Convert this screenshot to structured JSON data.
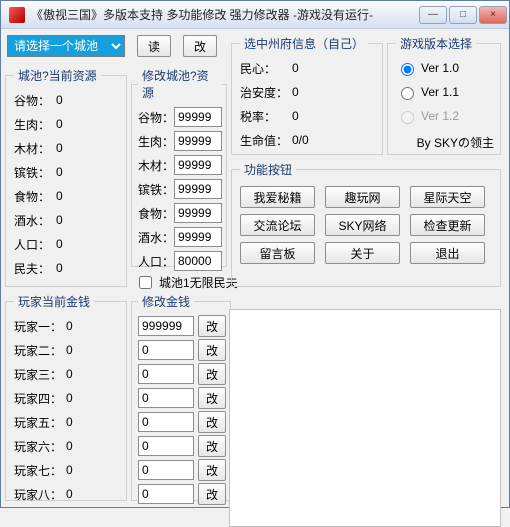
{
  "title": "《傲视三国》多版本支持 多功能修改 强力修改器    -游戏没有运行-",
  "window_buttons": {
    "min": "—",
    "max": "□",
    "close": "×"
  },
  "city_select": {
    "placeholder": "请选择一个城池"
  },
  "top_buttons": {
    "read": "读",
    "write": "改"
  },
  "current_resources": {
    "legend": "城池?当前资源",
    "items": [
      {
        "label": "谷物：",
        "value": "0"
      },
      {
        "label": "生肉：",
        "value": "0"
      },
      {
        "label": "木材：",
        "value": "0"
      },
      {
        "label": "镔铁：",
        "value": "0"
      },
      {
        "label": "食物：",
        "value": "0"
      },
      {
        "label": "酒水：",
        "value": "0"
      },
      {
        "label": "人口：",
        "value": "0"
      },
      {
        "label": "民夫：",
        "value": "0"
      }
    ]
  },
  "edit_resources": {
    "legend": "修改城池?资源",
    "items": [
      {
        "label": "谷物：",
        "value": "99999"
      },
      {
        "label": "生肉：",
        "value": "99999"
      },
      {
        "label": "木材：",
        "value": "99999"
      },
      {
        "label": "镔铁：",
        "value": "99999"
      },
      {
        "label": "食物：",
        "value": "99999"
      },
      {
        "label": "酒水：",
        "value": "99999"
      },
      {
        "label": "人口：",
        "value": "80000"
      }
    ]
  },
  "infinite_villager": {
    "label": "城池1无限民夫"
  },
  "center_info": {
    "legend": "选中州府信息（自己）",
    "rows": [
      {
        "label": "民心：",
        "value": "0"
      },
      {
        "label": "治安度：",
        "value": "0"
      },
      {
        "label": "税率：",
        "value": "0"
      },
      {
        "label": "生命值：",
        "value": "0/0"
      }
    ]
  },
  "version": {
    "legend": "游戏版本选择",
    "options": [
      {
        "label": "Ver 1.0",
        "checked": true,
        "disabled": false
      },
      {
        "label": "Ver 1.1",
        "checked": false,
        "disabled": false
      },
      {
        "label": "Ver 1.2",
        "checked": false,
        "disabled": true
      }
    ],
    "credit": "By SKYの领主"
  },
  "func": {
    "legend": "功能按钮",
    "buttons": [
      "我爱秘籍",
      "趣玩网",
      "星际天空",
      "交流论坛",
      "SKY网络",
      "检查更新",
      "留言板",
      "关于",
      "退出"
    ]
  },
  "player_money_current": {
    "legend": "玩家当前金钱",
    "rows": [
      {
        "label": "玩家一：",
        "value": "0"
      },
      {
        "label": "玩家二：",
        "value": "0"
      },
      {
        "label": "玩家三：",
        "value": "0"
      },
      {
        "label": "玩家四：",
        "value": "0"
      },
      {
        "label": "玩家五：",
        "value": "0"
      },
      {
        "label": "玩家六：",
        "value": "0"
      },
      {
        "label": "玩家七：",
        "value": "0"
      },
      {
        "label": "玩家八：",
        "value": "0"
      }
    ]
  },
  "player_money_edit": {
    "legend": "修改金钱",
    "rows": [
      {
        "value": "999999"
      },
      {
        "value": "0"
      },
      {
        "value": "0"
      },
      {
        "value": "0"
      },
      {
        "value": "0"
      },
      {
        "value": "0"
      },
      {
        "value": "0"
      },
      {
        "value": "0"
      }
    ],
    "btn": "改"
  }
}
